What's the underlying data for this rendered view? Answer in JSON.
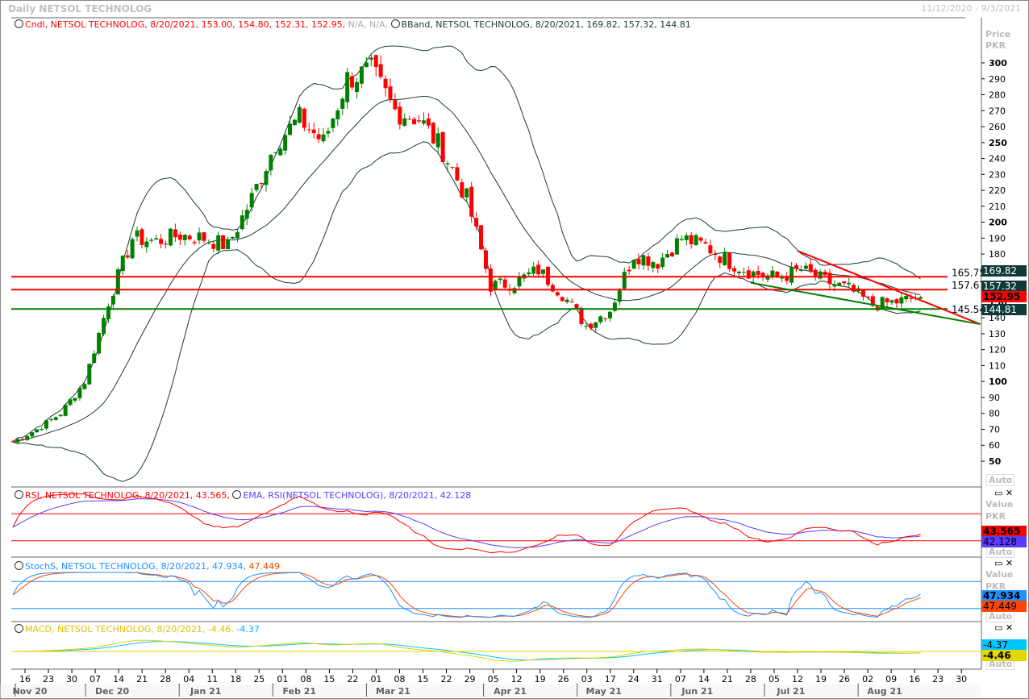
{
  "header": {
    "title": "Daily NETSOL TECHNOLOG",
    "range": "11/12/2020 - 9/3/2021"
  },
  "legends": {
    "candle": "Cndl, NETSOL TECHNOLOG, 8/20/2021, 153.00, 154.80, 152.31, 152.95,",
    "candle_na": "N/A, N/A,",
    "bband": "BBand, NETSOL TECHNOLOG, 8/20/2021, 169.82, 157.32, 144.81",
    "rsi": "RSI, NETSOL TECHNOLOG, 8/20/2021, 43.565,",
    "rsi_ema": "EMA, RSI(NETSOL TECHNOLOG), 8/20/2021, 42.128",
    "stoch": "StochS, NETSOL TECHNOLOG, 8/20/2021, 47.934,",
    "stoch2": "47.449",
    "macd": "MACD, NETSOL TECHNOLOG, 8/20/2021, -4.46,",
    "macd2": "-4.37"
  },
  "axis_labels": {
    "price": "Price",
    "value": "Value",
    "unit": "PKR",
    "auto": "Auto"
  },
  "value_tags": {
    "bb_upper": "169.82",
    "bb_mid": "157.32",
    "close": "152.95",
    "bb_lower": "144.81",
    "rsi": "43.565",
    "rsi_ema": "42.128",
    "stoch_k": "47.934",
    "stoch_d": "47.449",
    "macd_signal": "-4.37",
    "macd": "-4.46"
  },
  "colors": {
    "up": "#008000",
    "down": "#ff0000",
    "rsi": "#ff0000",
    "rsi_ema": "#5a3cff",
    "stoch_k": "#1e90ff",
    "stoch_d": "#ff4500",
    "macd": "#e0d000",
    "macd_signal": "#00c8ff"
  },
  "chart_data": {
    "type": "candlestick",
    "title": "Daily NETSOL TECHNOLOG",
    "ylabel": "Price PKR",
    "ylim": [
      40,
      310
    ],
    "yticks": [
      50,
      60,
      70,
      80,
      90,
      100,
      110,
      120,
      130,
      140,
      150,
      160,
      170,
      180,
      190,
      200,
      210,
      220,
      230,
      240,
      250,
      260,
      270,
      280,
      290,
      300
    ],
    "x_ticks": [
      "16",
      "23",
      "30",
      "07",
      "14",
      "21",
      "28",
      "04",
      "11",
      "18",
      "25",
      "01",
      "08",
      "15",
      "22",
      "01",
      "08",
      "15",
      "22",
      "29",
      "05",
      "12",
      "19",
      "26",
      "03",
      "17",
      "24",
      "31",
      "07",
      "14",
      "21",
      "28",
      "05",
      "12",
      "19",
      "26",
      "02",
      "09",
      "16",
      "23",
      "30"
    ],
    "months": [
      {
        "label": "Nov 20",
        "tick": 0
      },
      {
        "label": "Dec 20",
        "tick": 3
      },
      {
        "label": "Jan 21",
        "tick": 7
      },
      {
        "label": "Feb 21",
        "tick": 11
      },
      {
        "label": "Mar 21",
        "tick": 15
      },
      {
        "label": "Apr 21",
        "tick": 20
      },
      {
        "label": "May 21",
        "tick": 24
      },
      {
        "label": "Jun 21",
        "tick": 28
      },
      {
        "label": "Jul 21",
        "tick": 32
      },
      {
        "label": "Aug 21",
        "tick": 36
      }
    ],
    "weekly_close_approx": [
      62,
      70,
      80,
      100,
      150,
      190,
      188,
      192,
      190,
      185,
      215,
      250,
      265,
      250,
      290,
      295,
      270,
      265,
      245,
      215,
      160,
      162,
      170,
      155,
      135,
      145,
      180,
      175,
      190,
      185,
      175,
      168,
      165,
      170,
      163,
      158,
      148,
      150,
      152.95
    ],
    "hlines": [
      {
        "value": 165.75,
        "label": "165.75",
        "color": "#ff0000"
      },
      {
        "value": 157.67,
        "label": "157.67",
        "color": "#ff0000"
      },
      {
        "value": 145.54,
        "label": "145.54",
        "color": "#008000"
      }
    ],
    "trendlines": [
      {
        "from_tick": 33,
        "from": 182,
        "to_tick": 40.8,
        "to": 136,
        "color": "#ff0000"
      },
      {
        "from_tick": 31,
        "from": 162,
        "to_tick": 40.8,
        "to": 136,
        "color": "#008000"
      }
    ],
    "rsi_levels": [
      70,
      30
    ],
    "stoch_levels": [
      80,
      20
    ]
  }
}
